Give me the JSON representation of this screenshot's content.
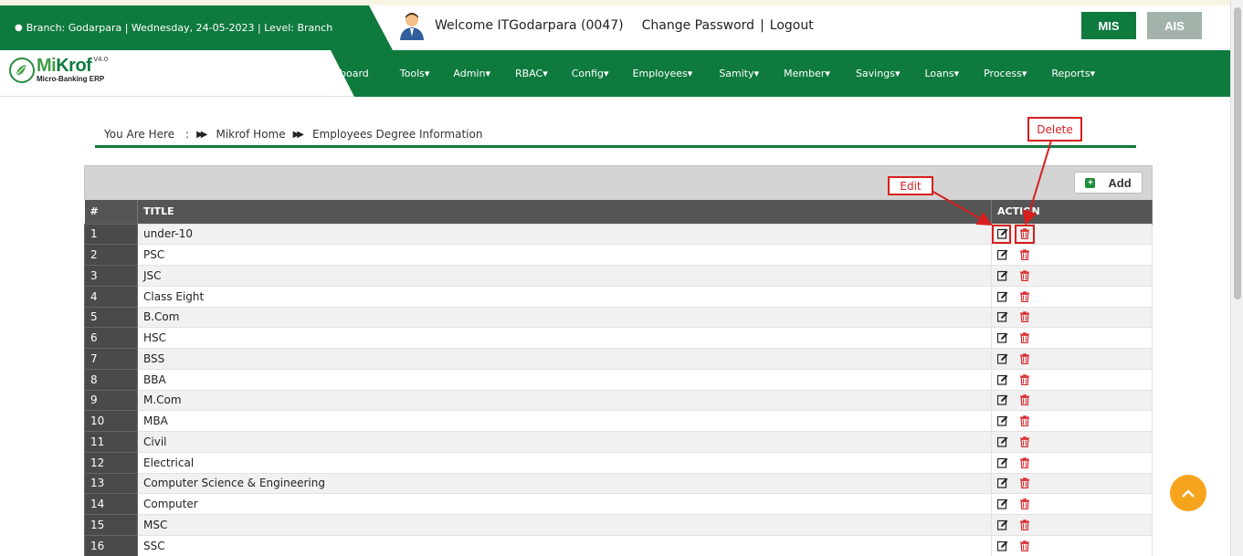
{
  "header": {
    "branch_info": "Branch: Godarpara | Wednesday, 24-05-2023 | Level: Branch",
    "welcome": "Welcome ITGodarpara (0047)",
    "change_password": "Change Password",
    "separator": "|",
    "logout": "Logout",
    "mis": "MIS",
    "ais": "AIS"
  },
  "logo": {
    "brand_m": "Mi",
    "brand_rest": "Krof",
    "version": "V4.0",
    "subtitle": "Micro-Banking ERP"
  },
  "menu": [
    {
      "label": "board",
      "name": "dashboard"
    },
    {
      "label": "Tools",
      "name": "tools"
    },
    {
      "label": "Admin",
      "name": "admin"
    },
    {
      "label": "RBAC",
      "name": "rbac"
    },
    {
      "label": "Config",
      "name": "config"
    },
    {
      "label": "Employees",
      "name": "employees"
    },
    {
      "label": "Samity",
      "name": "samity"
    },
    {
      "label": "Member",
      "name": "member"
    },
    {
      "label": "Savings",
      "name": "savings"
    },
    {
      "label": "Loans",
      "name": "loans"
    },
    {
      "label": "Process",
      "name": "process"
    },
    {
      "label": "Reports",
      "name": "reports"
    }
  ],
  "breadcrumb": {
    "prefix": "You Are Here",
    "colon": ":",
    "home": "Mikrof Home",
    "current": "Employees Degree Information"
  },
  "panel": {
    "add_label": "Add"
  },
  "table": {
    "headers": {
      "idx": "#",
      "title": "TITLE",
      "action": "ACTION"
    },
    "rows": [
      {
        "idx": "1",
        "title": "under-10"
      },
      {
        "idx": "2",
        "title": "PSC"
      },
      {
        "idx": "3",
        "title": "JSC"
      },
      {
        "idx": "4",
        "title": "Class Eight"
      },
      {
        "idx": "5",
        "title": "B.Com"
      },
      {
        "idx": "6",
        "title": "HSC"
      },
      {
        "idx": "7",
        "title": "BSS"
      },
      {
        "idx": "8",
        "title": "BBA"
      },
      {
        "idx": "9",
        "title": "M.Com"
      },
      {
        "idx": "10",
        "title": "MBA"
      },
      {
        "idx": "11",
        "title": "Civil"
      },
      {
        "idx": "12",
        "title": "Electrical"
      },
      {
        "idx": "13",
        "title": "Computer Science & Engineering"
      },
      {
        "idx": "14",
        "title": "Computer"
      },
      {
        "idx": "15",
        "title": "MSC"
      },
      {
        "idx": "16",
        "title": "SSC"
      }
    ]
  },
  "annotations": {
    "edit": "Edit",
    "delete": "Delete"
  },
  "colors": {
    "primary_green": "#0f7a3e",
    "annotation_red": "#d81e1e",
    "scroll_top_orange": "#f6a41e"
  }
}
